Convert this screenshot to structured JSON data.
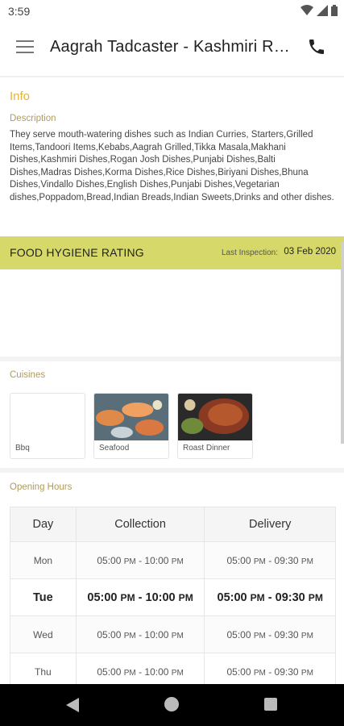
{
  "status_bar": {
    "time": "3:59"
  },
  "app_bar": {
    "title": "Aagrah Tadcaster - Kashmiri Restaurant"
  },
  "info": {
    "title": "Info",
    "description_label": "Description",
    "description": "They serve mouth-watering dishes such as Indian Curries, Starters,Grilled Items,Tandoori Items,Kebabs,Aagrah Grilled,Tikka Masala,Makhani Dishes,Kashmiri Dishes,Rogan Josh Dishes,Punjabi Dishes,Balti Dishes,Madras Dishes,Korma Dishes,Rice Dishes,Biriyani Dishes,Bhuna Dishes,Vindallo Dishes,English Dishes,Punjabi Dishes,Vegetarian dishes,Poppadom,Bread,Indian Breads,Indian Sweets,Drinks  and other dishes."
  },
  "food_hygiene": {
    "title": "FOOD HYGIENE RATING",
    "last_inspection_label": "Last Inspection:",
    "last_inspection_date": "03 Feb 2020"
  },
  "cuisines": {
    "label": "Cuisines",
    "items": [
      {
        "name": "Bbq",
        "image": "none"
      },
      {
        "name": "Seafood",
        "image": "seafood-photo"
      },
      {
        "name": "Roast Dinner",
        "image": "grilled-meat-photo"
      }
    ]
  },
  "opening_hours": {
    "label": "Opening Hours",
    "headers": [
      "Day",
      "Collection",
      "Delivery"
    ],
    "rows": [
      {
        "day": "Mon",
        "collection_open": "05:00",
        "collection_open_ampm": "PM",
        "collection_close": "10:00",
        "collection_close_ampm": "PM",
        "delivery_open": "05:00",
        "delivery_open_ampm": "PM",
        "delivery_close": "09:30",
        "delivery_close_ampm": "PM",
        "today": false
      },
      {
        "day": "Tue",
        "collection_open": "05:00",
        "collection_open_ampm": "PM",
        "collection_close": "10:00",
        "collection_close_ampm": "PM",
        "delivery_open": "05:00",
        "delivery_open_ampm": "PM",
        "delivery_close": "09:30",
        "delivery_close_ampm": "PM",
        "today": true
      },
      {
        "day": "Wed",
        "collection_open": "05:00",
        "collection_open_ampm": "PM",
        "collection_close": "10:00",
        "collection_close_ampm": "PM",
        "delivery_open": "05:00",
        "delivery_open_ampm": "PM",
        "delivery_close": "09:30",
        "delivery_close_ampm": "PM",
        "today": false
      },
      {
        "day": "Thu",
        "collection_open": "05:00",
        "collection_open_ampm": "PM",
        "collection_close": "10:00",
        "collection_close_ampm": "PM",
        "delivery_open": "05:00",
        "delivery_open_ampm": "PM",
        "delivery_close": "09:30",
        "delivery_close_ampm": "PM",
        "today": false
      }
    ]
  },
  "colors": {
    "accent": "#e2b43a",
    "hygiene_bar": "#d6d96a",
    "section_label": "#b09a5d"
  },
  "icons": [
    "wifi-icon",
    "signal-icon",
    "battery-icon",
    "menu-icon",
    "phone-icon",
    "back-icon",
    "home-icon",
    "recents-icon"
  ]
}
